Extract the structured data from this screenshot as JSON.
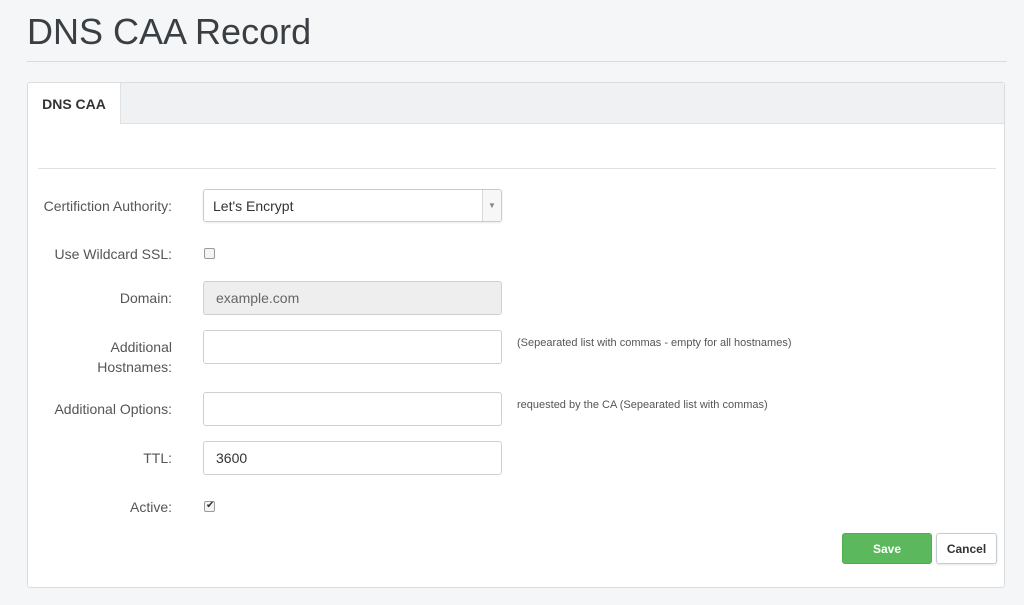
{
  "page": {
    "title": "DNS CAA Record"
  },
  "tabs": [
    {
      "label": "DNS CAA",
      "active": true
    }
  ],
  "form": {
    "ca_label": "Certifiction Authority:",
    "ca_value": "Let's Encrypt",
    "wildcard_label": "Use Wildcard SSL:",
    "wildcard_checked": false,
    "domain_label": "Domain:",
    "domain_value": "example.com",
    "hostnames_label_line1": "Additional",
    "hostnames_label_line2": "Hostnames:",
    "hostnames_value": "",
    "hostnames_hint": "(Sepearated list with commas - empty for all hostnames)",
    "options_label": "Additional Options:",
    "options_value": "",
    "options_hint": "requested by the CA (Sepearated list with commas)",
    "ttl_label": "TTL:",
    "ttl_value": "3600",
    "active_label": "Active:",
    "active_checked": true
  },
  "buttons": {
    "save": "Save",
    "cancel": "Cancel"
  },
  "colors": {
    "save_button": "#5cb85c",
    "background": "#f5f6f7"
  },
  "icons": {
    "select_arrow": "chevron-down-icon",
    "checkmark": "checkmark-icon"
  }
}
